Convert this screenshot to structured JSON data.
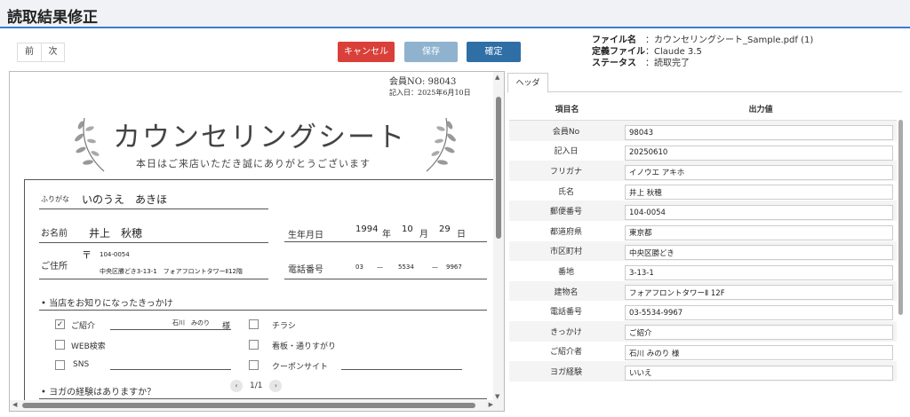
{
  "app": {
    "title": "読取結果修正"
  },
  "nav": {
    "prev": "前",
    "next": "次"
  },
  "actions": {
    "cancel": "キャンセル",
    "save": "保存",
    "confirm": "確定"
  },
  "fileinfo": [
    {
      "key": "ファイル名",
      "value": "：カウンセリングシート_Sample.pdf (1)"
    },
    {
      "key": "定義ファイル",
      "value": "：Claude 3.5"
    },
    {
      "key": "ステータス",
      "value": "：読取完了"
    }
  ],
  "doc": {
    "member_no": "会員NO: 98043",
    "entry_date": "記入日：2025年6月10日",
    "title": "カウンセリングシート",
    "subtitle": "本日はご来店いただき誠にありがとうございます",
    "furigana_label": "ふりがな",
    "furigana_value": "いのうえ　あきほ",
    "name_label": "お名前",
    "name_value": "井上　秋穂",
    "birth_label": "生年月日",
    "birth_year": "1994",
    "birth_year_unit": "年",
    "birth_month": "10",
    "birth_month_unit": "月",
    "birth_day": "29",
    "birth_day_unit": "日",
    "address_label": "ご住所",
    "postal_mark": "〒",
    "postal_value": "104-0054",
    "address_value": "中央区勝どき3-13-1　フォアフロントタワーⅡ12階",
    "phone_label": "電話番号",
    "phone_1": "03",
    "phone_dash_1": "—",
    "phone_2": "5534",
    "phone_dash_2": "—",
    "phone_3": "9967",
    "q1": "• 当店をお知りになったきっかけ",
    "opt_referral": "ご紹介",
    "referrer": "石川　みのり",
    "referrer_suffix": "様",
    "opt_web": "WEB検索",
    "opt_sns": "SNS",
    "opt_flyer": "チラシ",
    "opt_sign": "看板・通りすがり",
    "opt_coupon": "クーポンサイト",
    "check_mark": "✓",
    "q2": "• ヨガの経験はありますか？",
    "page": "1/1",
    "prev_page": "‹",
    "next_page": "›"
  },
  "panel": {
    "tab": "ヘッダ",
    "col_name": "項目名",
    "col_value": "出力値",
    "rows": [
      {
        "label": "会員No",
        "value": "98043"
      },
      {
        "label": "記入日",
        "value": "20250610"
      },
      {
        "label": "フリガナ",
        "value": "イノウエ アキホ"
      },
      {
        "label": "氏名",
        "value": "井上 秋穂"
      },
      {
        "label": "郵便番号",
        "value": "104-0054"
      },
      {
        "label": "都道府県",
        "value": "東京都"
      },
      {
        "label": "市区町村",
        "value": "中央区勝どき"
      },
      {
        "label": "番地",
        "value": "3-13-1"
      },
      {
        "label": "建物名",
        "value": "フォアフロントタワーⅡ 12F"
      },
      {
        "label": "電話番号",
        "value": "03-5534-9967"
      },
      {
        "label": "きっかけ",
        "value": "ご紹介"
      },
      {
        "label": "ご紹介者",
        "value": "石川 みのり 様"
      },
      {
        "label": "ヨガ経験",
        "value": "いいえ"
      }
    ]
  }
}
